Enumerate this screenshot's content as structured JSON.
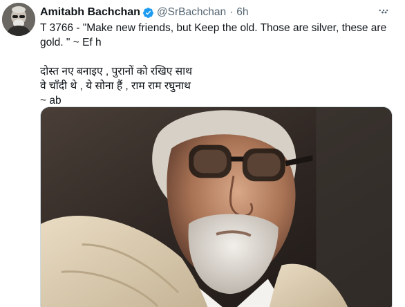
{
  "author": {
    "name": "Amitabh Bachchan",
    "handle": "@SrBachchan",
    "separator": "·",
    "time": "6h",
    "verified": true,
    "avatar_icon": "user-avatar"
  },
  "tweet": {
    "line1": "T 3766 - \"Make new friends, but Keep the old. Those are silver, these are",
    "line2": "gold. \" ~ Ef h",
    "hindi1": "दोस्त नए बनाइए , पुरानों को रखिए साथ",
    "hindi2": "वे चाँदी थे , ये सोना हैं , राम राम रघुनाथ",
    "sign": "~ ab"
  },
  "icons": {
    "verified": "verified-badge-icon",
    "more": "more-options-icon"
  },
  "colors": {
    "verified_blue": "#1d9bf0",
    "secondary_text": "#536471",
    "primary_text": "#0f1419"
  },
  "media": {
    "type": "photo"
  }
}
